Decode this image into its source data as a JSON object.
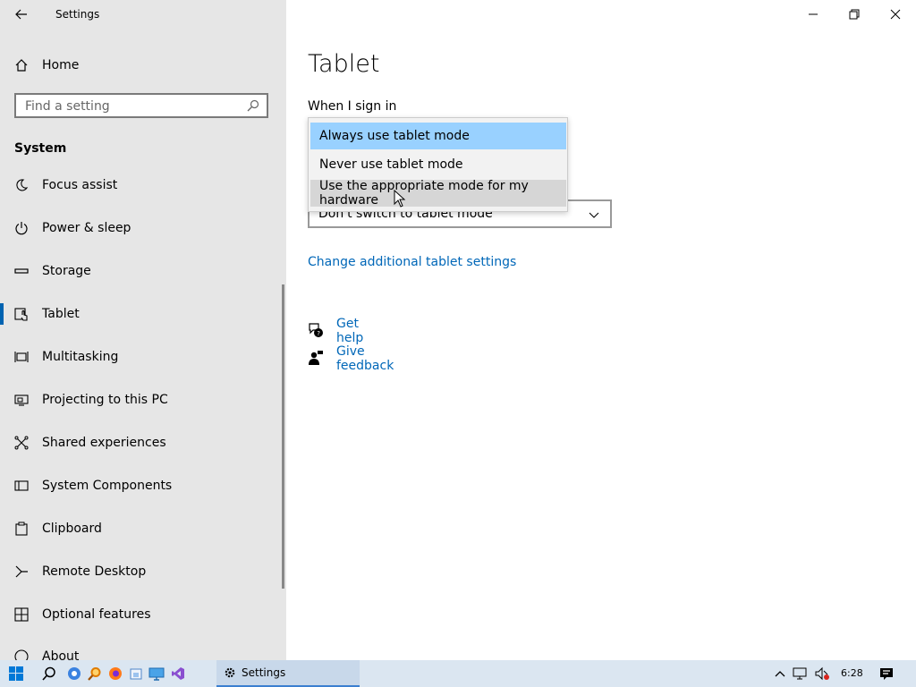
{
  "window": {
    "app_title": "Settings"
  },
  "sidebar": {
    "home_label": "Home",
    "search_placeholder": "Find a setting",
    "section_title": "System",
    "items": [
      {
        "label": "Focus assist",
        "icon": "moon-icon"
      },
      {
        "label": "Power & sleep",
        "icon": "power-icon"
      },
      {
        "label": "Storage",
        "icon": "storage-icon"
      },
      {
        "label": "Tablet",
        "icon": "tablet-icon",
        "selected": true
      },
      {
        "label": "Multitasking",
        "icon": "multitasking-icon"
      },
      {
        "label": "Projecting to this PC",
        "icon": "projecting-icon"
      },
      {
        "label": "Shared experiences",
        "icon": "shared-experiences-icon"
      },
      {
        "label": "System Components",
        "icon": "system-components-icon"
      },
      {
        "label": "Clipboard",
        "icon": "clipboard-icon"
      },
      {
        "label": "Remote Desktop",
        "icon": "remote-desktop-icon"
      },
      {
        "label": "Optional features",
        "icon": "optional-features-icon"
      },
      {
        "label": "About",
        "icon": "info-icon"
      }
    ]
  },
  "main": {
    "title": "Tablet",
    "sign_in_label": "When I sign in",
    "dropdown_options": [
      "Always use tablet mode",
      "Never use tablet mode",
      "Use the appropriate mode for my hardware"
    ],
    "highlighted_option": "Always use tablet mode",
    "combo_value": "Don't switch to tablet mode",
    "link_additional": "Change additional tablet settings",
    "get_help": "Get help",
    "give_feedback": "Give feedback"
  },
  "taskbar": {
    "app_label": "Settings",
    "time": "6:28"
  },
  "colors": {
    "accent": "#0063b1",
    "link": "#0067b8",
    "highlight": "#99d1ff",
    "sidebar_bg": "#e6e6e6"
  }
}
